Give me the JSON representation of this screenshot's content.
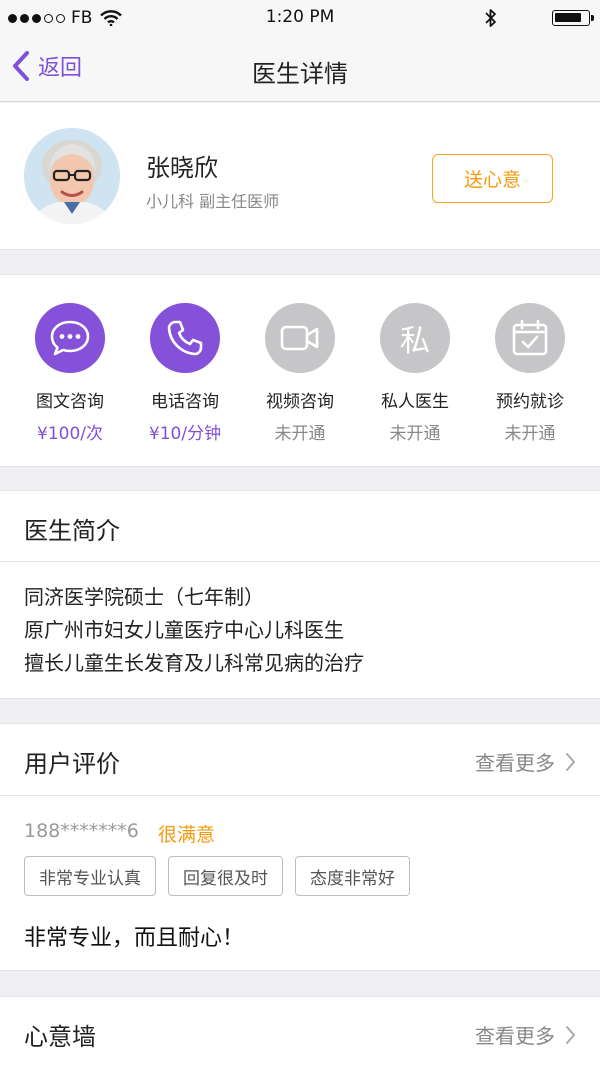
{
  "status_bar": {
    "carrier": "FB",
    "time": "1:20 PM"
  },
  "nav": {
    "back_label": "返回",
    "title": "医生详情"
  },
  "doctor": {
    "name": "张晓欣",
    "subtitle": "小儿科  副主任医师",
    "gift_button": "送心意"
  },
  "services": [
    {
      "icon": "chat-bubble-icon",
      "label": "图文咨询",
      "price": "¥100/次",
      "enabled": true
    },
    {
      "icon": "phone-icon",
      "label": "电话咨询",
      "price": "¥10/分钟",
      "enabled": true
    },
    {
      "icon": "video-camera-icon",
      "label": "视频咨询",
      "price": "未开通",
      "enabled": false
    },
    {
      "icon": "private-icon",
      "label": "私人医生",
      "price": "未开通",
      "enabled": false,
      "glyph": "私"
    },
    {
      "icon": "calendar-icon",
      "label": "预约就诊",
      "price": "未开通",
      "enabled": false
    }
  ],
  "intro": {
    "title": "医生简介",
    "lines": [
      "同济医学院硕士（七年制）",
      "原广州市妇女儿童医疗中心儿科医生",
      "擅长儿童生长发育及儿科常见病的治疗"
    ]
  },
  "reviews": {
    "title": "用户评价",
    "more_label": "查看更多",
    "item": {
      "user": "188*******6",
      "rating": "很满意",
      "tags": [
        "非常专业认真",
        "回复很及时",
        "态度非常好"
      ],
      "comment": "非常专业，而且耐心！"
    }
  },
  "gift_wall": {
    "title": "心意墙",
    "more_label": "查看更多"
  },
  "colors": {
    "accent": "#8451d8",
    "orange": "#f59a0f",
    "inactive": "#c6c6c9"
  }
}
